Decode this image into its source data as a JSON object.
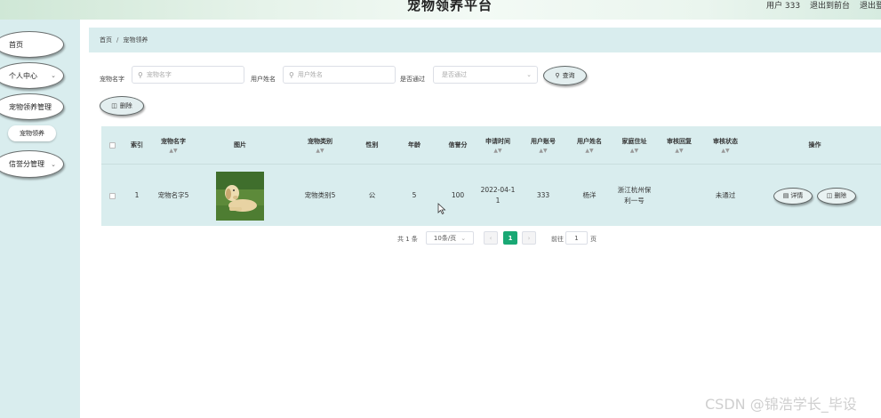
{
  "header": {
    "title": "宠物领养平台",
    "user_label": "用户 333",
    "back_front": "退出到前台",
    "logout": "退出登"
  },
  "sidebar": {
    "items": [
      {
        "label": "首页"
      },
      {
        "label": "个人中心",
        "icon": "chevron-down-icon"
      },
      {
        "label": "宠物领养管理"
      },
      {
        "label": "宠物领养"
      },
      {
        "label": "信誉分管理",
        "icon": "chevron-down-icon"
      }
    ]
  },
  "breadcrumb": {
    "home": "首页",
    "separator": "/",
    "current": "宠物领养"
  },
  "search": {
    "pet_name_label": "宠物名字",
    "pet_name_placeholder": "宠物名字",
    "user_name_label": "用户姓名",
    "user_name_placeholder": "用户姓名",
    "approved_label": "是否通过",
    "approved_placeholder": "是否通过",
    "query_button": "查询",
    "delete_button": "删除"
  },
  "table": {
    "columns": [
      "索引",
      "宠物名字",
      "图片",
      "宠物类别",
      "性别",
      "年龄",
      "信誉分",
      "申请时间",
      "用户账号",
      "用户姓名",
      "家庭住址",
      "审核回复",
      "审核状态",
      "操作"
    ],
    "rows": [
      {
        "index": "1",
        "pet_name": "宠物名字5",
        "image_icon": "dog-photo",
        "category": "宠物类别5",
        "gender": "公",
        "age": "5",
        "credit": "100",
        "apply_time_line1": "2022-04-1",
        "apply_time_line2": "1",
        "account": "333",
        "user_name": "杨洋",
        "address_line1": "浙江杭州保",
        "address_line2": "利一号",
        "reply": "",
        "status": "未通过",
        "detail_button": "详情",
        "delete_button": "删除"
      }
    ]
  },
  "pagination": {
    "total": "共 1 条",
    "page_size": "10条/页",
    "current_page": "1",
    "goto_label": "前往",
    "goto_value": "1",
    "page_suffix": "页"
  },
  "watermark": "CSDN @锦浩学长_毕设",
  "colors": {
    "accent": "#19a874",
    "panel": "#d9edee"
  }
}
